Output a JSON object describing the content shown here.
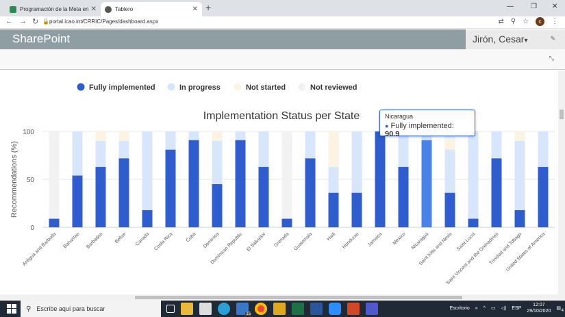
{
  "browser": {
    "tabs": [
      {
        "title": "Programación de la Meta en el Ti",
        "active": false
      },
      {
        "title": "Tablero",
        "active": true
      }
    ],
    "url": "portal.icao.int/CRRIC/Pages/dashboard.aspx",
    "profile_initial": "c"
  },
  "sharepoint": {
    "brand": "SharePoint",
    "user_name": "Jirón, Cesar",
    "user_caret": "▾"
  },
  "taskbar": {
    "search_placeholder": "Escribe aquí para buscar",
    "desktop_label": "Escritorio",
    "language": "ESP",
    "time": "12:07",
    "date": "29/10/2020",
    "mail_badge": "15",
    "notification_count": "4"
  },
  "tooltip": {
    "state": "Nicaragua",
    "series": "Fully implemented",
    "value": "90.9"
  },
  "chart_data": {
    "type": "bar",
    "stacked": true,
    "title": "Implementation Status per State",
    "ylabel": "Recommendations (%)",
    "ylim": [
      0,
      100
    ],
    "yticks": [
      "0",
      "50",
      "100"
    ],
    "legend_position": "top",
    "categories": [
      "Antigua and Barbuda",
      "Bahamas",
      "Barbados",
      "Belize",
      "Canada",
      "Costa Rica",
      "Cuba",
      "Dominica",
      "Dominican Republic",
      "El Salvador",
      "Grenada",
      "Guatemala",
      "Haiti",
      "Honduras",
      "Jamaica",
      "Mexico",
      "Nicaragua",
      "Saint Kitts and Nevis",
      "Saint Lucia",
      "Saint Vincent and the Grenadines",
      "Trinidad and Tobago",
      "United States of America"
    ],
    "series": [
      {
        "name": "Fully implemented",
        "color": "#2f5dcd",
        "values": [
          9,
          54,
          63,
          72,
          18,
          81,
          91,
          45,
          91,
          63,
          9,
          72,
          36,
          36,
          100,
          63,
          91,
          36,
          9,
          72,
          18,
          63
        ]
      },
      {
        "name": "In progress",
        "color": "#d7e6fa",
        "values": [
          0,
          46,
          27,
          18,
          82,
          19,
          9,
          45,
          9,
          37,
          0,
          28,
          27,
          64,
          0,
          37,
          9,
          45,
          91,
          28,
          72,
          37
        ]
      },
      {
        "name": "Not started",
        "color": "#fdf3e2",
        "values": [
          0,
          0,
          10,
          10,
          0,
          0,
          0,
          10,
          0,
          0,
          0,
          0,
          37,
          0,
          0,
          0,
          0,
          10,
          0,
          0,
          10,
          0
        ]
      },
      {
        "name": "Not reviewed",
        "color": "#f2f2f2",
        "values": [
          91,
          0,
          0,
          0,
          0,
          0,
          0,
          0,
          0,
          0,
          91,
          0,
          0,
          0,
          0,
          0,
          0,
          9,
          0,
          0,
          0,
          0
        ]
      }
    ],
    "highlighted_category": "Nicaragua",
    "highlight_color": "#4a82e8"
  }
}
